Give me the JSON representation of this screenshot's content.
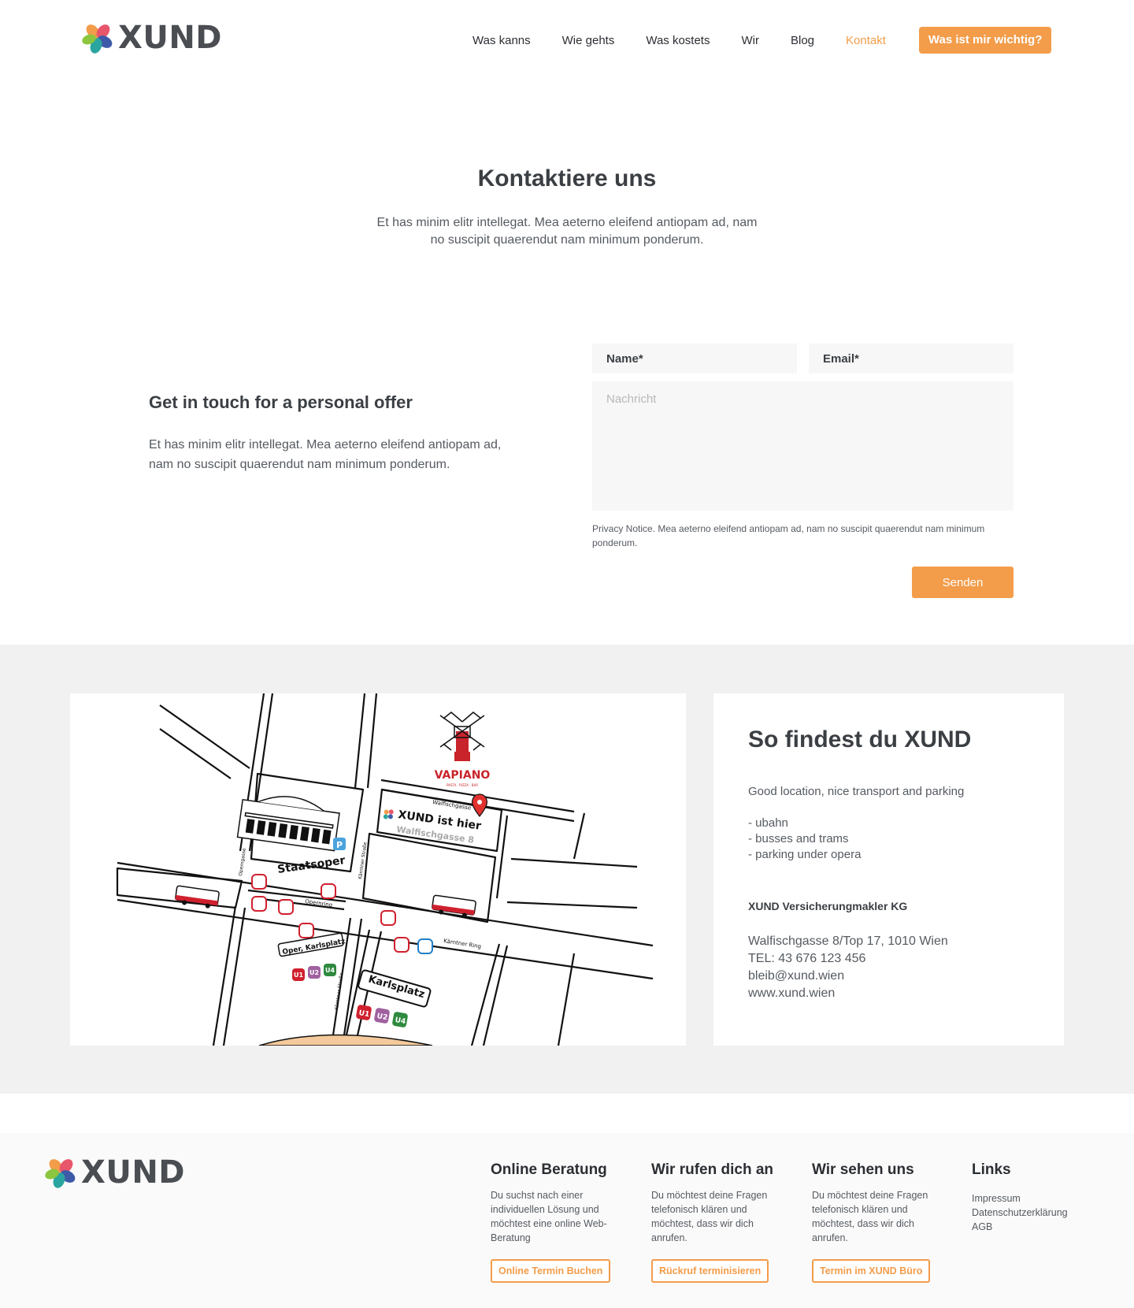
{
  "brand": {
    "name": "XUND",
    "accent": "#f39c4a",
    "text": "#3b3f44"
  },
  "nav": {
    "items": [
      {
        "label": "Was kanns"
      },
      {
        "label": "Wie gehts"
      },
      {
        "label": "Was kostets"
      },
      {
        "label": "Wir"
      },
      {
        "label": "Blog"
      },
      {
        "label": "Kontakt",
        "active": true
      }
    ],
    "cta": "Was ist mir wichtig?"
  },
  "hero": {
    "title": "Kontaktiere uns",
    "text": "Et has minim elitr intellegat. Mea aeterno eleifend antiopam ad, nam no suscipit quaerendut nam minimum ponderum."
  },
  "contact": {
    "title": "Get in touch for a personal offer",
    "text": "Et has minim elitr intellegat. Mea aeterno eleifend antiopam ad, nam no suscipit quaerendut nam minimum ponderum.",
    "form": {
      "name_placeholder": "Name*",
      "email_placeholder": "Email*",
      "message_placeholder": "Nachricht",
      "privacy": "Privacy Notice. Mea aeterno eleifend antiopam ad, nam no suscipit quaerendut nam minimum ponderum.",
      "submit": "Senden"
    }
  },
  "map": {
    "labels": {
      "vapiano": "VAPIANO",
      "vapiano_sub": "PASTA · PIZZA · BAR",
      "walfischgasse": "Walfischgasse",
      "xund_here": "XUND ist hier",
      "address": "Walfischgasse 8",
      "staatsoper": "Staatsoper",
      "parking": "P",
      "opernring": "Opernring",
      "operngasse": "Operngasse",
      "kaertner_strasse": "Kärntner Straße",
      "kaertner_ring": "Kärntner Ring",
      "oper_karlsplatz": "Oper, Karlsplatz",
      "karlsplatz": "Karlsplatz",
      "u1": "U1",
      "u2": "U2",
      "u4": "U4"
    },
    "line_colors": {
      "u1": "#d0202e",
      "u2": "#a0619f",
      "u4": "#2e8a3e",
      "tram": "#d0202e",
      "bus": "#1e7fc8"
    }
  },
  "location": {
    "title": "So findest du XUND",
    "subtitle": "Good location, nice transport and parking",
    "features": [
      "- ubahn",
      "- busses and trams",
      "- parking under opera"
    ],
    "company": "XUND Versicherungmakler KG",
    "address": "Walfischgasse 8/Top 17, 1010 Wien",
    "phone": "TEL: 43 676 123 456",
    "email": "bleib@xund.wien",
    "website": "www.xund.wien"
  },
  "footer": {
    "columns": [
      {
        "title": "Online Beratung",
        "text": "Du suchst nach einer individuellen Lösung und möchtest eine online Web-Beratung",
        "button": "Online Termin Buchen"
      },
      {
        "title": "Wir rufen dich an",
        "text": "Du möchtest deine Fragen telefonisch klären und möchtest, dass wir dich anrufen.",
        "button": "Rückruf terminisieren"
      },
      {
        "title": "Wir sehen uns",
        "text": "Du möchtest deine Fragen telefonisch klären und möchtest, dass wir dich anrufen.",
        "button": "Termin im XUND Büro"
      }
    ],
    "links": {
      "title": "Links",
      "items": [
        "Impressum",
        "Datenschutzerklärung",
        "AGB"
      ]
    }
  }
}
